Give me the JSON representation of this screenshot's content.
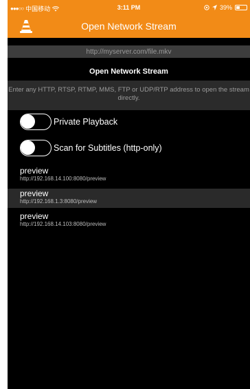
{
  "status_bar": {
    "carrier": "中国移动",
    "wifi_icon": "wifi-icon",
    "time": "3:11 PM",
    "battery_percent": "39%",
    "battery_level": 0.39
  },
  "navbar": {
    "title": "Open Network Stream",
    "logo_icon": "vlc-cone-icon"
  },
  "url_field": {
    "value": "http://myserver.com/file.mkv"
  },
  "open_button": {
    "label": "Open Network Stream"
  },
  "description": "Enter any HTTP, RTSP, RTMP, MMS, FTP or UDP/RTP address to open the stream directly.",
  "toggles": [
    {
      "label": "Private Playback",
      "on": false
    },
    {
      "label": "Scan for Subtitles (http-only)",
      "on": false
    }
  ],
  "streams": [
    {
      "title": "preview",
      "url": "http://192.168.14.100:8080/preview"
    },
    {
      "title": "preview",
      "url": "http://192.168.1.3:8080/preview"
    },
    {
      "title": "preview",
      "url": "http://192.168.14.103:8080/preview"
    }
  ],
  "colors": {
    "accent": "#f28b17",
    "background": "#000000",
    "field": "#3d3d3d"
  }
}
